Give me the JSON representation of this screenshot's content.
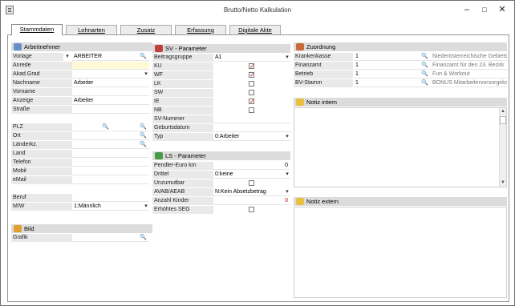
{
  "window": {
    "title": "Brutto/Netto Kalkulation"
  },
  "tabs": [
    "Stammdaten",
    "Lohnarten",
    "Zusatz",
    "Erfassung",
    "Digitale Akte"
  ],
  "arbeitnehmer": {
    "title": "Arbeitnehmer",
    "vorlage_label": "Vorlage",
    "vorlage_value": "ARBEITER",
    "rows": [
      {
        "label": "Anrede",
        "value": ""
      },
      {
        "label": "Akad.Grad",
        "value": ""
      },
      {
        "label": "Nachname",
        "value": "Arbeiter"
      },
      {
        "label": "Vorname",
        "value": ""
      },
      {
        "label": "Anzeige",
        "value": "Arbeiter"
      },
      {
        "label": "Straße",
        "value": ""
      }
    ],
    "address": [
      {
        "label": "PLZ",
        "value": ""
      },
      {
        "label": "Ort",
        "value": ""
      },
      {
        "label": "Länderkz.",
        "value": ""
      },
      {
        "label": "Land",
        "value": ""
      },
      {
        "label": "Telefon",
        "value": ""
      },
      {
        "label": "Mobil",
        "value": ""
      },
      {
        "label": "eMail",
        "value": ""
      }
    ],
    "beruf_label": "Beruf",
    "mw_label": "M/W",
    "mw_value": "1:Männlich"
  },
  "bild": {
    "title": "Bild",
    "grafik_label": "Grafik"
  },
  "sv": {
    "title": "SV - Parameter",
    "beitragsgruppe_label": "Beitragsgruppe",
    "beitragsgruppe_value": "A1",
    "checks": [
      {
        "label": "KU",
        "checked": true
      },
      {
        "label": "WF",
        "checked": true
      },
      {
        "label": "LK",
        "checked": false
      },
      {
        "label": "SW",
        "checked": false
      },
      {
        "label": "IE",
        "checked": true
      },
      {
        "label": "NB",
        "checked": false
      }
    ],
    "svnummer_label": "SV-Nummer",
    "geburtsdatum_label": "Geburtsdatum",
    "typ_label": "Typ",
    "typ_value": "0:Arbeiter"
  },
  "ls": {
    "title": "LS - Parameter",
    "pendler_label": "Pendler-Euro km",
    "pendler_value": "0",
    "drittel_label": "Drittel",
    "drittel_value": "0:keine",
    "unzumutbar_label": "Unzumutbar",
    "avab_label": "AVAB/AEAB",
    "avab_value": "N:Kein Absetzbetrag",
    "kinder_label": "Anzahl Kinder",
    "kinder_value": "0",
    "seg_label": "Erhöhtes SEG"
  },
  "zuordnung": {
    "title": "Zuordnung",
    "rows": [
      {
        "label": "Krankenkasse",
        "value": "1",
        "desc": "Niederösterreichische Gebietskr"
      },
      {
        "label": "Finanzamt",
        "value": "1",
        "desc": "Finanzamt für den 23. Bezirk"
      },
      {
        "label": "Betrieb",
        "value": "1",
        "desc": "Fun & Workout"
      },
      {
        "label": "BV-Stamm",
        "value": "1",
        "desc": "BONUS Mitarbeitervorsorgekass"
      }
    ]
  },
  "notiz_intern": {
    "title": "Notiz intern"
  },
  "notiz_extern": {
    "title": "Notiz extern"
  },
  "colors": {
    "accent_red": "#d00000",
    "section_bg": "#dcdcdc",
    "label_bg": "#e9e9e9",
    "highlight": "#fff9d6"
  }
}
